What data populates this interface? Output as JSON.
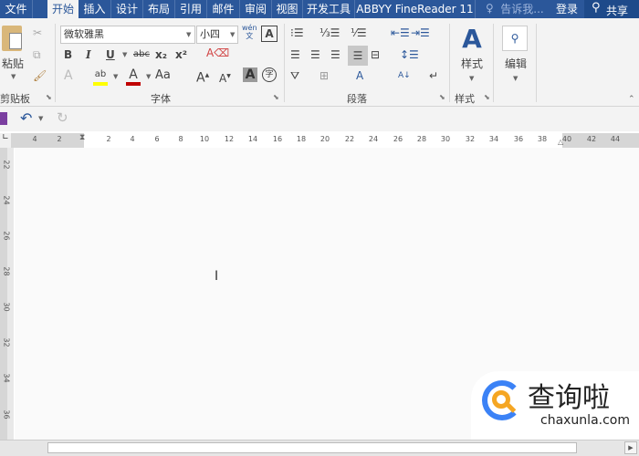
{
  "tabs": [
    "文件",
    "开始",
    "插入",
    "设计",
    "布局",
    "引用",
    "邮件",
    "审阅",
    "视图",
    "开发工具",
    "ABBYY FineReader 11"
  ],
  "active_tab": "开始",
  "tell_me": "告诉我...",
  "login": "登录",
  "share": "共享",
  "clipboard": {
    "paste": "粘贴",
    "group": "剪贴板"
  },
  "font": {
    "name": "微软雅黑",
    "size": "小四",
    "group": "字体",
    "phonetic": "wén\n文",
    "bold": "B",
    "italic": "I",
    "underline": "U",
    "strike": "abc",
    "sub": "x₂",
    "sup": "x²",
    "case": "Aa"
  },
  "paragraph": {
    "group": "段落"
  },
  "styles": {
    "label": "样式",
    "group": "样式"
  },
  "editing": {
    "label": "编辑"
  },
  "ruler_h": [
    "4",
    "2",
    "2",
    "4",
    "6",
    "8",
    "10",
    "12",
    "14",
    "16",
    "18",
    "20",
    "22",
    "24",
    "26",
    "28",
    "30",
    "32",
    "34",
    "36",
    "38",
    "40",
    "42",
    "44"
  ],
  "ruler_v": [
    "22",
    "24",
    "26",
    "28",
    "30",
    "32",
    "34",
    "36"
  ],
  "watermark": {
    "name": "查询啦",
    "url": "chaxunla.com"
  },
  "colors": {
    "title_bar": "#2b579a",
    "ribbon": "#f3f3f3",
    "highlight": "#ffff00",
    "font_color": "#c00000",
    "logo_blue": "#3b82f6",
    "logo_orange": "#f5a623"
  }
}
